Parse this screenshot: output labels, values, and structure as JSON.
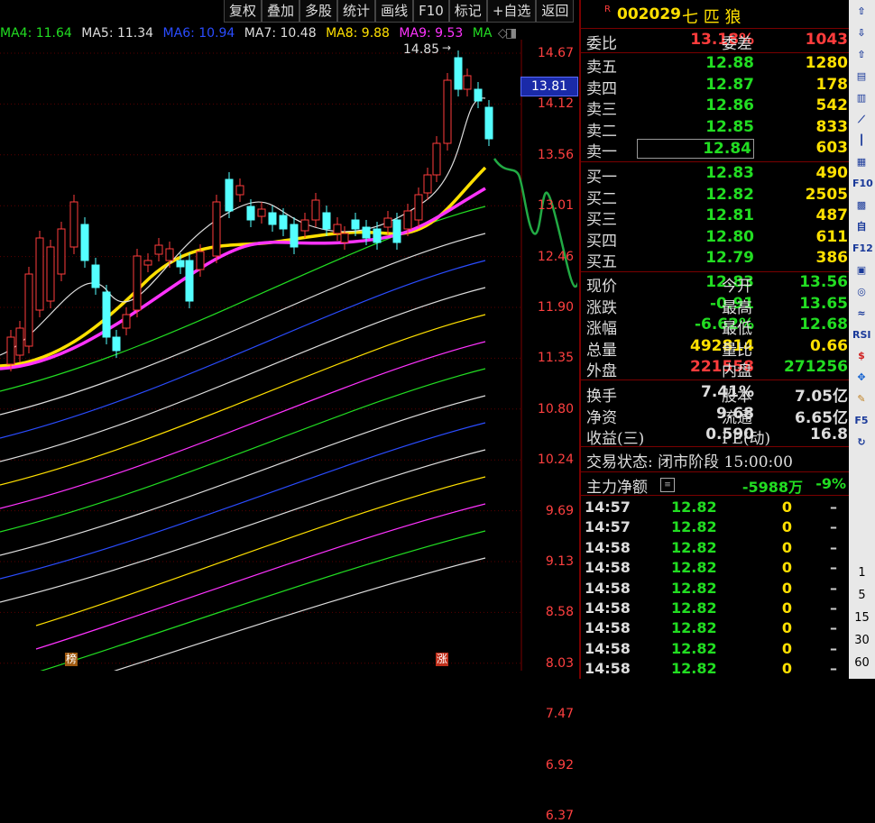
{
  "toolbar": [
    "复权",
    "叠加",
    "多股",
    "统计",
    "画线",
    "F10",
    "标记",
    "+自选",
    "返回"
  ],
  "ma_legend": [
    {
      "label": "MA4: 11.64",
      "color": "#22dd22"
    },
    {
      "label": "MA5: 11.34",
      "color": "#dddddd"
    },
    {
      "label": "MA6: 10.94",
      "color": "#2a4cff"
    },
    {
      "label": "MA7: 10.48",
      "color": "#dddddd"
    },
    {
      "label": "MA8: 9.88",
      "color": "#ffe000"
    },
    {
      "label": "MA9: 9.53",
      "color": "#ff33ff"
    },
    {
      "label": "MA",
      "color": "#22dd22"
    }
  ],
  "price_ticks": [
    "14.67",
    "14.12",
    "13.56",
    "13.01",
    "12.46",
    "11.90",
    "11.35",
    "10.80",
    "10.24",
    "9.69",
    "9.13",
    "8.58",
    "8.03",
    "7.47",
    "6.92",
    "6.37"
  ],
  "current_price_label": "13.81",
  "peak_label": "14.85",
  "markers": {
    "rank": "榜",
    "rise": "涨"
  },
  "stock": {
    "badge": "R",
    "code": "002029",
    "name": "七 匹 狼"
  },
  "quote": {
    "weibi_label": "委比",
    "weibi": "13.18%",
    "weicha_label": "委差",
    "weicha": "1043",
    "sell": [
      {
        "label": "卖五",
        "price": "12.88",
        "vol": "1280"
      },
      {
        "label": "卖四",
        "price": "12.87",
        "vol": "178"
      },
      {
        "label": "卖三",
        "price": "12.86",
        "vol": "542"
      },
      {
        "label": "卖二",
        "price": "12.85",
        "vol": "833"
      },
      {
        "label": "卖一",
        "price": "12.84",
        "vol": "603"
      }
    ],
    "buy": [
      {
        "label": "买一",
        "price": "12.83",
        "vol": "490"
      },
      {
        "label": "买二",
        "price": "12.82",
        "vol": "2505"
      },
      {
        "label": "买三",
        "price": "12.81",
        "vol": "487"
      },
      {
        "label": "买四",
        "price": "12.80",
        "vol": "611"
      },
      {
        "label": "买五",
        "price": "12.79",
        "vol": "386"
      }
    ],
    "stats": [
      {
        "l1": "现价",
        "v1": "12.83",
        "c1": "g",
        "l2": "今开",
        "v2": "13.56",
        "c2": "g"
      },
      {
        "l1": "涨跌",
        "v1": "-0.91",
        "c1": "g",
        "l2": "最高",
        "v2": "13.65",
        "c2": "g"
      },
      {
        "l1": "涨幅",
        "v1": "-6.62%",
        "c1": "g",
        "l2": "最低",
        "v2": "12.68",
        "c2": "g"
      },
      {
        "l1": "总量",
        "v1": "492814",
        "c1": "y",
        "l2": "量比",
        "v2": "0.66",
        "c2": "y"
      },
      {
        "l1": "外盘",
        "v1": "221558",
        "c1": "r",
        "l2": "内盘",
        "v2": "271256",
        "c2": "g"
      },
      {
        "l1": "换手",
        "v1": "7.41%",
        "c1": "w",
        "l2": "股本",
        "v2": "7.05亿",
        "c2": "w"
      },
      {
        "l1": "净资",
        "v1": "9.68",
        "c1": "w",
        "l2": "流通",
        "v2": "6.65亿",
        "c2": "w"
      },
      {
        "l1": "收益(三)",
        "v1": "0.590",
        "c1": "w",
        "l2": "PE(动)",
        "v2": "16.8",
        "c2": "w"
      }
    ],
    "trade_status": "交易状态: 闭市阶段 15:00:00",
    "main_flow_label": "主力净额",
    "main_flow_value": "-5988万",
    "main_flow_pct": "-9%"
  },
  "ticks": [
    {
      "time": "14:57",
      "price": "12.82",
      "vol": "0",
      "dir": "–"
    },
    {
      "time": "14:57",
      "price": "12.82",
      "vol": "0",
      "dir": "–"
    },
    {
      "time": "14:58",
      "price": "12.82",
      "vol": "0",
      "dir": "–"
    },
    {
      "time": "14:58",
      "price": "12.82",
      "vol": "0",
      "dir": "–"
    },
    {
      "time": "14:58",
      "price": "12.82",
      "vol": "0",
      "dir": "–"
    },
    {
      "time": "14:58",
      "price": "12.82",
      "vol": "0",
      "dir": "–"
    },
    {
      "time": "14:58",
      "price": "12.82",
      "vol": "0",
      "dir": "–"
    },
    {
      "time": "14:58",
      "price": "12.82",
      "vol": "0",
      "dir": "–"
    },
    {
      "time": "14:58",
      "price": "12.82",
      "vol": "0",
      "dir": "–"
    }
  ],
  "side_icons": [
    "up-arrow-icon",
    "down-arrow-icon",
    "up-arrow-icon",
    "list-icon",
    "bar-chart-icon",
    "line-chart-icon",
    "candlestick-icon",
    "table-icon",
    "f10-icon",
    "grid-icon",
    "self-select-icon",
    "f12-icon",
    "box-icon",
    "circle-icon",
    "wave-icon",
    "rsi-icon",
    "dollar-icon",
    "move-icon",
    "pen-icon",
    "f5-icon",
    "refresh-icon"
  ],
  "side_labels": {
    "f10": "F10",
    "f12": "F12",
    "rsi": "RSI",
    "f5": "F5"
  },
  "period_numbers": [
    "1",
    "5",
    "15",
    "30",
    "60"
  ]
}
